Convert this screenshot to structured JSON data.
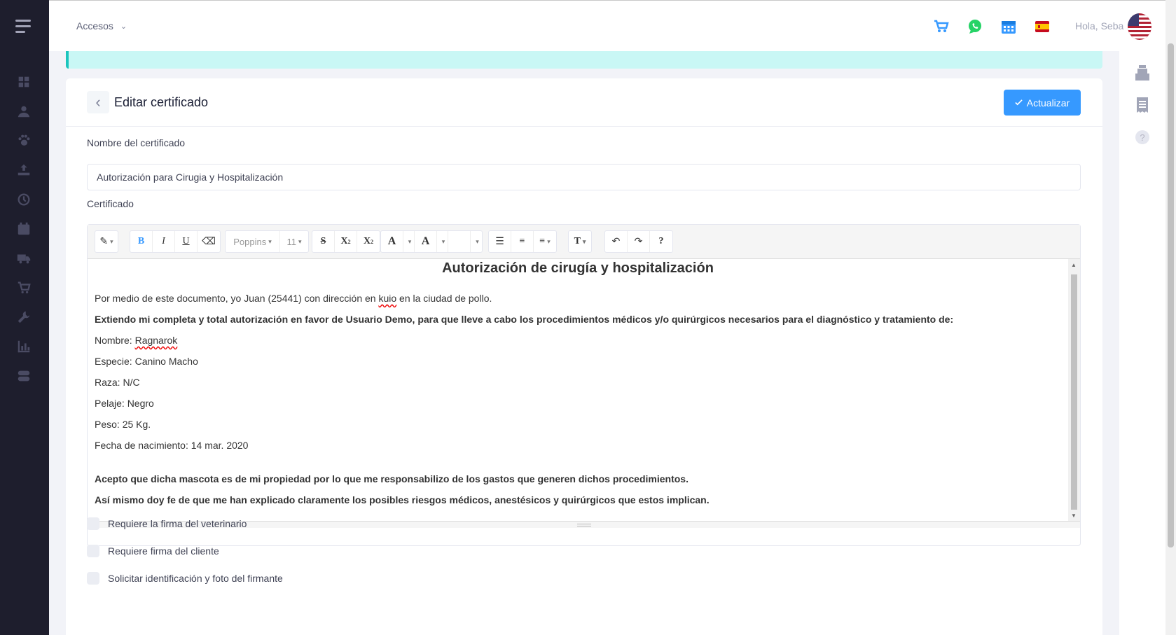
{
  "header": {
    "accesos_label": "Accesos",
    "greeting": "Hola, Seba"
  },
  "card": {
    "title": "Editar certificado",
    "update_button": "Actualizar"
  },
  "form": {
    "name_label": "Nombre del certificado",
    "name_value": "Autorización para Cirugia y Hospitalización",
    "certificate_label": "Certificado"
  },
  "toolbar": {
    "font_family": "Poppins",
    "font_size": "11"
  },
  "document": {
    "title": "Autorización de cirugía y hospitalización",
    "intro_before": "Por medio de este documento, yo Juan (25441) con dirección en ",
    "intro_misspelled": "kuio",
    "intro_after": " en la ciudad de pollo.",
    "authorization": "Extiendo mi completa y total autorización en favor de Usuario Demo, para que lleve a cabo los procedimientos médicos y/o quirúrgicos necesarios para el diagnóstico y tratamiento de:",
    "nombre_label": "Nombre: ",
    "nombre_value": "Ragnarok",
    "especie": "Especie: Canino Macho",
    "raza": "Raza: N/C",
    "pelaje": "Pelaje: Negro",
    "peso": "Peso: 25 Kg.",
    "fecha": "Fecha de nacimiento: 14 mar. 2020",
    "acepto": "Acepto que dicha mascota es de mi propiedad por lo que me responsabilizo de los gastos que generen dichos procedimientos.",
    "asimismo": "Así mismo doy fe de que me han explicado claramente los posibles riesgos médicos, anestésicos y quirúrgicos que estos implican."
  },
  "checkboxes": [
    {
      "label": "Requiere la firma del veterinario",
      "checked": false
    },
    {
      "label": "Requiere firma del cliente",
      "checked": false
    },
    {
      "label": "Solicitar identificación y foto del firmante",
      "checked": false
    }
  ],
  "colors": {
    "sidebar": "#1e1e2d",
    "primary": "#3699ff",
    "whatsapp": "#25d366",
    "notice": "#c9f7f5"
  }
}
